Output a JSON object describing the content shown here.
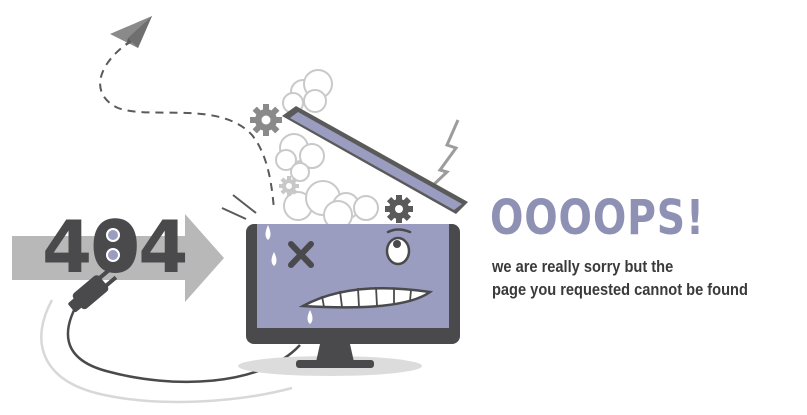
{
  "error": {
    "code": "404",
    "headline": "OOOOPS!",
    "message_line_1": "we are really sorry but the",
    "message_line_2": "page you requested cannot be found"
  },
  "icons": [
    "paper-plane-icon",
    "arrow-icon",
    "power-plug-icon",
    "monitor-icon",
    "gear-icon",
    "smoke-cloud-icon",
    "lightning-icon"
  ],
  "colors": {
    "screen": "#9a9cc0",
    "headline": "#8f91b4",
    "monitor_frame": "#4a4a4c",
    "arrow": "#b8b8b8",
    "text": "#3a3a3a"
  }
}
